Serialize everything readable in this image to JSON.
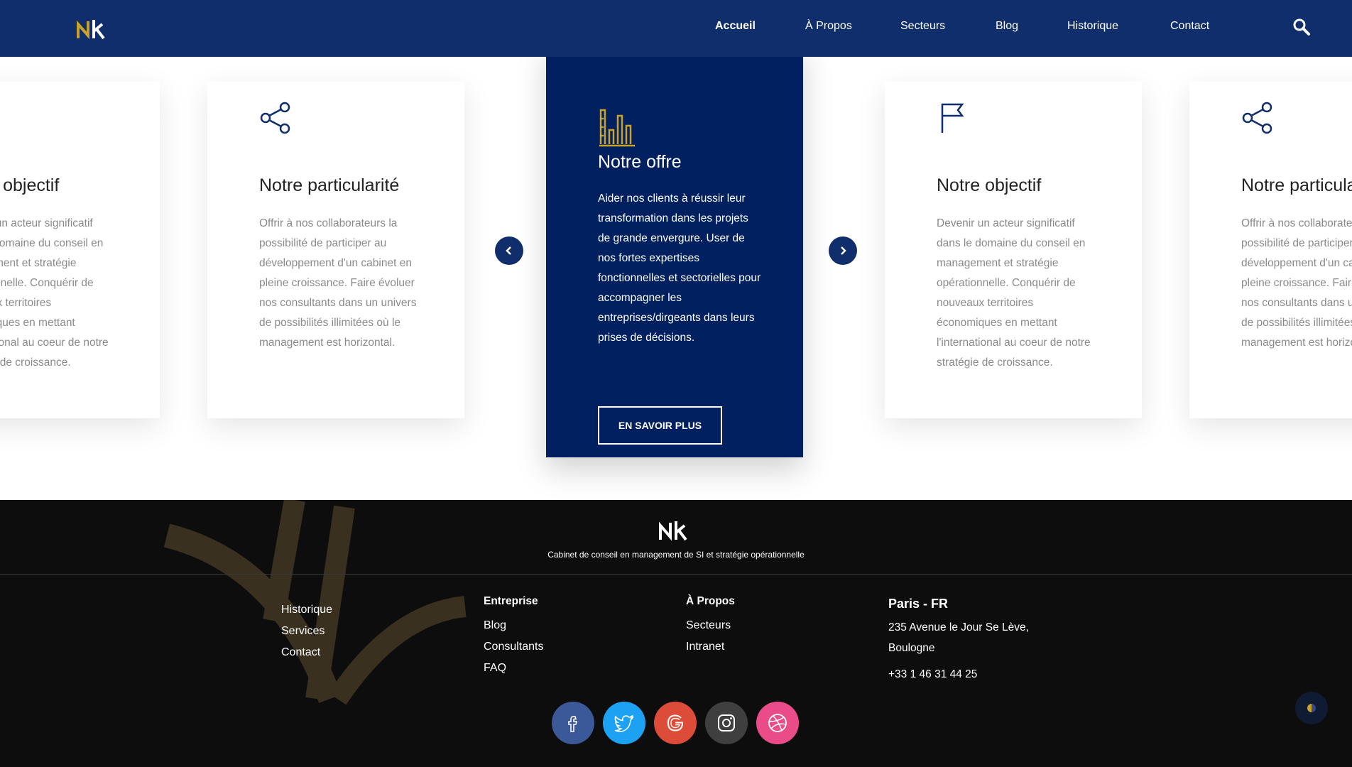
{
  "nav": {
    "items": [
      {
        "label": "Accueil",
        "active": true
      },
      {
        "label": "À Propos",
        "active": false
      },
      {
        "label": "Secteurs",
        "active": false
      },
      {
        "label": "Blog",
        "active": false
      },
      {
        "label": "Historique",
        "active": false
      },
      {
        "label": "Contact",
        "active": false
      }
    ],
    "search_icon": "search-icon"
  },
  "cards": [
    {
      "title": "Notre objectif",
      "icon": "flag-icon",
      "text": "Devenir un acteur significatif dans le domaine du conseil en management et stratégie opérationnelle. Conquérir de nouveaux territoires économiques en mettant l'international au coeur de notre stratégie de croissance."
    },
    {
      "title": "Notre particularité",
      "icon": "share-icon",
      "text": "Offrir à nos collaborateurs la possibilité de participer au développement d'un cabinet en pleine croissance. Faire évoluer nos consultants dans un univers de possibilités illimitées où le management est horizontal."
    },
    {
      "title": "Notre offre",
      "icon": "bar-chart-icon",
      "text": "Aider nos clients à réussir leur transformation dans les projets de grande envergure. User de nos fortes expertises fonctionnelles et sectorielles pour accompagner les entreprises/dirgeants dans leurs prises de décisions.",
      "cta": "EN SAVOIR PLUS"
    },
    {
      "title": "Notre objectif",
      "icon": "flag-icon",
      "text": "Devenir un acteur significatif dans le domaine du conseil en management et stratégie opérationnelle. Conquérir de nouveaux territoires économiques en mettant l'international au coeur de notre stratégie de croissance."
    },
    {
      "title": "Notre particularité",
      "icon": "share-icon",
      "text": "Offrir à nos collaborateurs la possibilité de participer au développement d'un cabinet en pleine croissance. Faire évoluer nos consultants dans un univers de possibilités illimitées où le management est horizontal."
    }
  ],
  "footer": {
    "tagline": "Cabinet de conseil en management de SI et stratégie opérationnelle",
    "col1": {
      "links": [
        "Historique",
        "Services",
        "Contact"
      ]
    },
    "col2": {
      "heading": "Entreprise",
      "links": [
        "Blog",
        "Consultants",
        "FAQ"
      ]
    },
    "col3": {
      "heading": "À Propos",
      "links": [
        "Secteurs",
        "Intranet"
      ]
    },
    "address": {
      "city": "Paris - FR",
      "line1": "235 Avenue le Jour Se Lève,",
      "line2": "Boulogne",
      "phone": "+33 1 46 31 44 25"
    },
    "social": [
      {
        "name": "facebook-icon",
        "color": "#3b5998"
      },
      {
        "name": "twitter-icon",
        "color": "#1da1f2"
      },
      {
        "name": "google-icon",
        "color": "#dd4b39"
      },
      {
        "name": "instagram-icon",
        "color": "#3f3f3f"
      },
      {
        "name": "dribbble-icon",
        "color": "#ea4c89"
      }
    ]
  },
  "colors": {
    "primary": "#0f2e6b",
    "featured": "#002060",
    "gold": "#c9a227",
    "footer_bg": "#0d0d0d"
  }
}
